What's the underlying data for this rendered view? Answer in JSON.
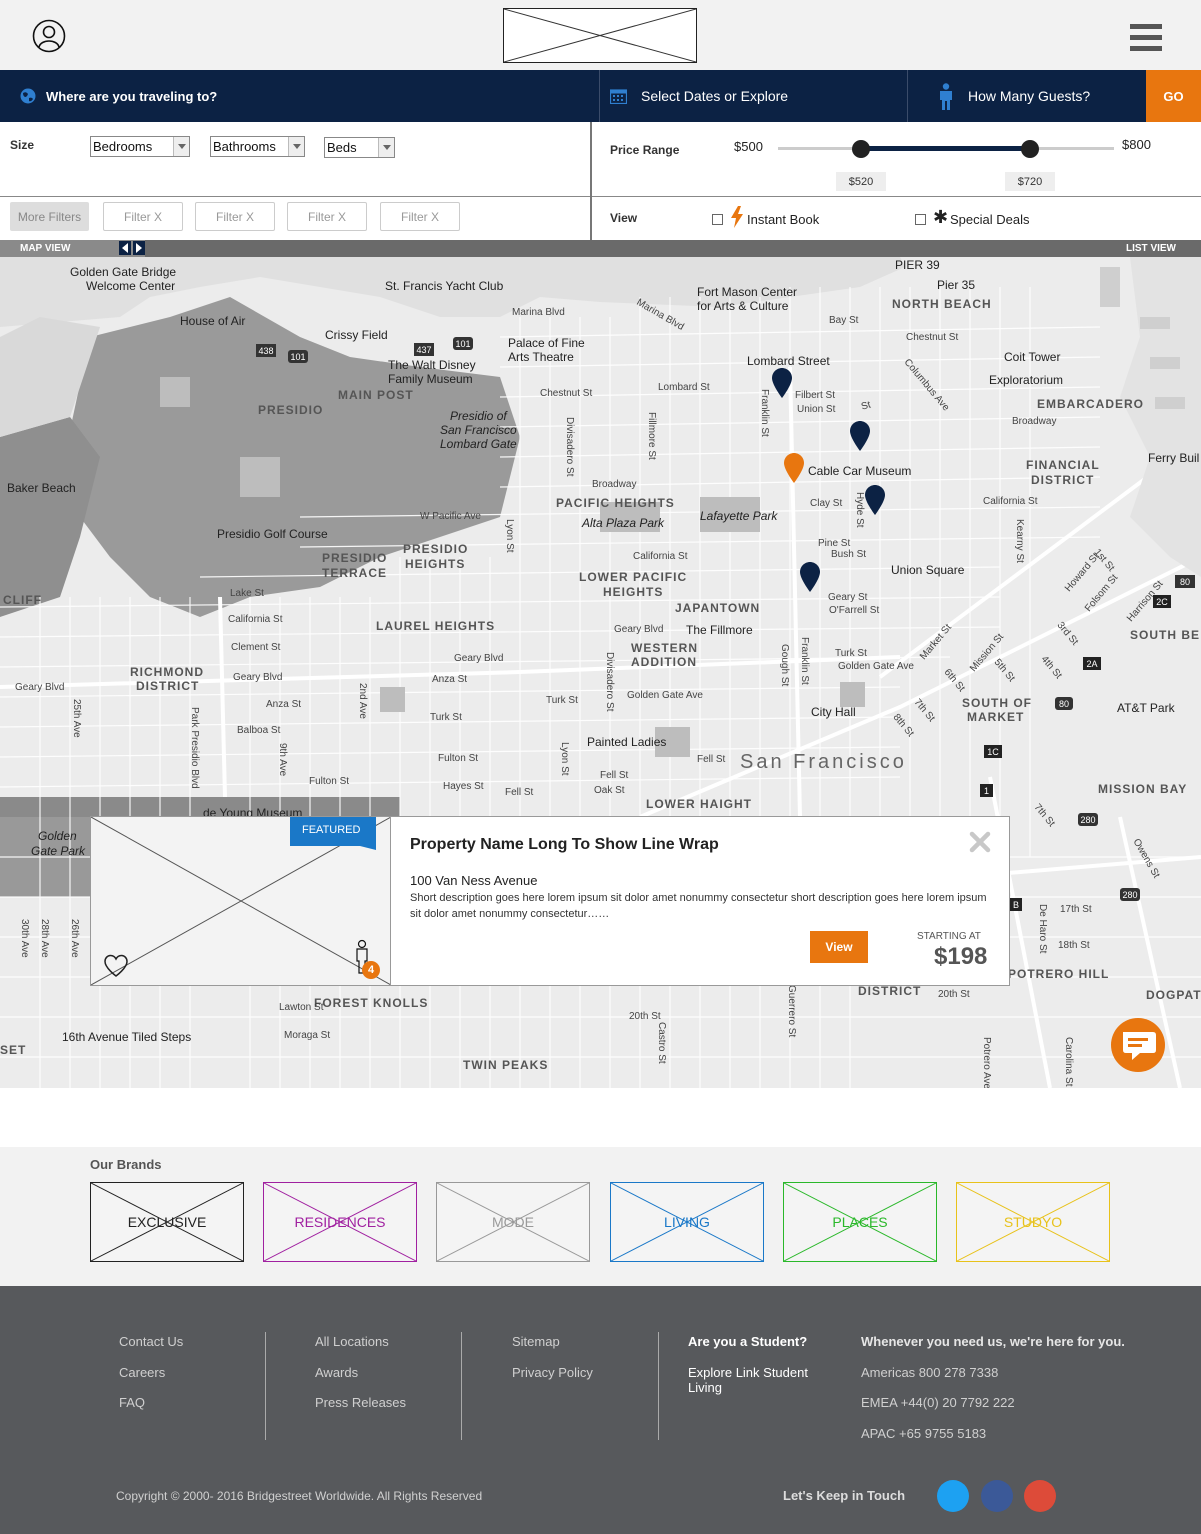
{
  "header": {
    "profile_icon": "user-circle-icon",
    "logo_icon": "logo-placeholder",
    "menu_icon": "hamburger-menu-icon"
  },
  "search": {
    "destination_label": "Where are you traveling to?",
    "dates_label": "Select Dates or Explore",
    "guests_label": "How Many Guests?",
    "go_label": "GO",
    "accent_color": "#e8760f",
    "bar_color": "#0c2244"
  },
  "filters": {
    "size_label": "Size",
    "bedrooms": "Bedrooms",
    "bathrooms": "Bathrooms",
    "beds": "Beds",
    "more_filters": "More Filters",
    "chips": [
      "Filter  X",
      "Filter  X",
      "Filter  X",
      "Filter  X"
    ],
    "price_label": "Price Range",
    "price_min": "$500",
    "price_max": "$800",
    "price_low": "$520",
    "price_high": "$720",
    "view_label": "View",
    "instant_book": "Instant Book",
    "special_deals": "Special Deals"
  },
  "view_toggle": {
    "map_view": "MAP VIEW",
    "list_view": "LIST VIEW"
  },
  "map": {
    "labels": {
      "gg_bridge": "Golden Gate Bridge",
      "welcome": "Welcome Center",
      "st_francis": "St. Francis Yacht Club",
      "fort_mason": "Fort Mason Center",
      "for_arts": "for Arts & Culture",
      "pier39": "PIER 39",
      "pier35": "Pier 35",
      "north_beach": "NORTH BEACH",
      "house_of_air": "House of Air",
      "crissy": "Crissy Field",
      "palace1": "Palace of Fine",
      "palace2": "Arts Theatre",
      "disney1": "The Walt Disney",
      "disney2": "Family Museum",
      "main_post": "MAIN POST",
      "presidio": "PRESIDIO",
      "lombard_street": "Lombard Street",
      "coit": "Coit Tower",
      "exploratorium": "Exploratorium",
      "embarcadero": "EMBARCADERO",
      "presidio_sf1": "Presidio of",
      "presidio_sf2": "San Francisco",
      "presidio_sf3": "Lombard Gate",
      "baker_beach": "Baker Beach",
      "cable_car": "Cable Car Museum",
      "ferry": "Ferry Buil",
      "financial1": "FINANCIAL",
      "financial2": "DISTRICT",
      "pacific_heights": "PACIFIC HEIGHTS",
      "alta_plaza": "Alta Plaza Park",
      "lafayette": "Lafayette Park",
      "presidio_golf": "Presidio Golf Course",
      "presidio_terrace1": "PRESIDIO",
      "presidio_terrace2": "TERRACE",
      "presidio_heights1": "PRESIDIO",
      "presidio_heights2": "HEIGHTS",
      "lower_pacific1": "LOWER PACIFIC",
      "lower_pacific2": "HEIGHTS",
      "union_square": "Union Square",
      "cliff": "CLIFF",
      "japantown": "JAPANTOWN",
      "laurel": "LAUREL HEIGHTS",
      "fillmore": "The Fillmore",
      "south_beach": "SOUTH BE",
      "richmond1": "RICHMOND",
      "richmond2": "DISTRICT",
      "western1": "WESTERN",
      "western2": "ADDITION",
      "south_market1": "SOUTH OF",
      "south_market2": "MARKET",
      "att_park": "AT&T Park",
      "city_hall": "City Hall",
      "painted_ladies": "Painted Ladies",
      "san_francisco": "San Francisco",
      "mission_bay": "MISSION BAY",
      "lower_haight": "LOWER HAIGHT",
      "de_young": "de Young Museum",
      "golden_gate_park1": "Golden",
      "golden_gate_park2": "Gate Park",
      "potrero": "POTRERO HILL",
      "dogpatch": "DOGPAT",
      "district": "DISTRICT",
      "forest_knolls": "FOREST KNOLLS",
      "tiled_steps": "16th Avenue Tiled Steps",
      "twin_peaks": "TWIN PEAKS",
      "set": "SET"
    },
    "streets": {
      "marina": "Marina Blvd",
      "bay": "Bay St",
      "chestnut": "Chestnut St",
      "lombard": "Lombard St",
      "filbert": "Filbert St",
      "union": "Union St",
      "broadway": "Broadway",
      "columbus": "Columbus Ave",
      "california": "California St",
      "clay": "Clay St",
      "pine": "Pine St",
      "bush": "Bush St",
      "geary": "Geary St",
      "ofarrell": "O'Farrell St",
      "turk": "Turk St",
      "golden_gate_ave": "Golden Gate Ave",
      "fell": "Fell St",
      "oak": "Oak St",
      "hayes": "Hayes St",
      "fulton": "Fulton St",
      "balboa": "Balboa St",
      "anza": "Anza St",
      "clement": "Clement St",
      "lake": "Lake St",
      "geary_blvd": "Geary Blvd",
      "park_presidio": "Park Presidio Blvd",
      "divisadero": "Divisadero St",
      "fillmore_st": "Fillmore St",
      "franklin": "Franklin St",
      "gough": "Gough St",
      "hyde": "Hyde St",
      "kearny": "Kearny St",
      "market": "Market St",
      "mission": "Mission St",
      "howard": "Howard St",
      "folsom": "Folsom St",
      "harrison": "Harrison St",
      "lyon": "Lyon St",
      "ave25": "25th Ave",
      "ave9": "9th Ave",
      "ave2": "2nd Ave",
      "w_pacific": "W Pacific Ave",
      "lawton": "Lawton St",
      "moraga": "Moraga St",
      "st20": "20th St",
      "st17": "17th St",
      "st18": "18th St",
      "guerrero": "Guerrero St",
      "castro": "Castro St",
      "dehara": "De Haro St",
      "carolina": "Carolina St",
      "potrero_ave": "Potrero Ave",
      "owens": "Owens St",
      "st7": "7th St",
      "st5": "5th St",
      "st6": "6th St",
      "st4": "4th St",
      "st3": "3rd St",
      "st1": "1st St",
      "st8": "8th St",
      "ave28": "28th Ave",
      "ave26": "26th Ave",
      "ave30": "30th Ave",
      "st": "St"
    },
    "shields": [
      "438",
      "101",
      "437",
      "101",
      "80",
      "2C",
      "2A",
      "1C",
      "1",
      "80",
      "280",
      "280",
      "B"
    ],
    "marker_color": "#0c2244",
    "selected_marker_color": "#e8760f"
  },
  "popup": {
    "featured": "FEATURED",
    "title": "Property Name Long To Show Line Wrap",
    "address": "100 Van Ness Avenue",
    "description": "Short description goes here lorem ipsum sit dolor amet nonummy consectetur short description goes here lorem ipsum sit dolor amet nonummy consectetur……",
    "view_button": "View",
    "starting_at": "STARTING AT",
    "price": "$198",
    "guests": "4"
  },
  "brands": {
    "title": "Our Brands",
    "items": [
      {
        "label": "EXCLUSIVE",
        "color": "#222222"
      },
      {
        "label": "RESIDENCES",
        "color": "#a020a0"
      },
      {
        "label": "MODE",
        "color": "#999999"
      },
      {
        "label": "LIVING",
        "color": "#1a78c8"
      },
      {
        "label": "PLACES",
        "color": "#2ab82a"
      },
      {
        "label": "STUDYO",
        "color": "#e8c21a"
      }
    ]
  },
  "footer": {
    "col1": [
      "Contact Us",
      "Careers",
      "FAQ"
    ],
    "col2": [
      "All Locations",
      "Awards",
      "Press Releases"
    ],
    "col3": [
      "Sitemap",
      "Privacy Policy"
    ],
    "student_title": "Are you a Student?",
    "student_link_line1": "Explore Link Student",
    "student_link_line2": "Living",
    "contact_title": "Whenever you need us, we're here for you.",
    "phones": [
      "Americas 800 278 7338",
      "EMEA +44(0) 20 7792 222",
      "APAC +65 9755 5183"
    ],
    "copyright": "Copyright © 2000- 2016 Bridgestreet Worldwide. All Rights Reserved",
    "keep_in_touch": "Let's Keep in Touch",
    "social_colors": [
      "#1da1f2",
      "#3b5998",
      "#dd4b39"
    ]
  }
}
